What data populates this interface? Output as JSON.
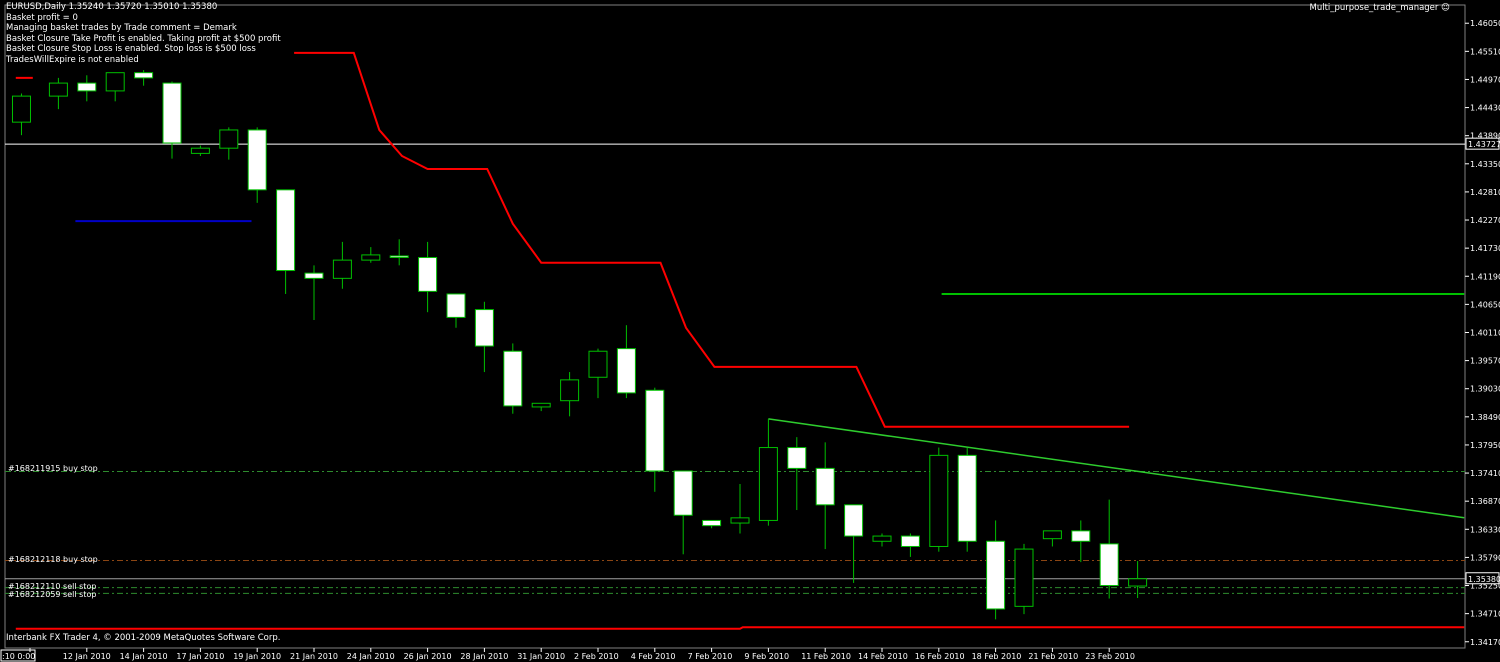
{
  "header": {
    "symbol_line": "EURUSD,Daily  1.35240 1.35720 1.35010 1.35380",
    "info_lines": [
      "Basket profit = 0",
      "Managing basket trades by Trade comment = Demark",
      "Basket Closure Take Profit is enabled. Taking profit at $500 profit",
      "Basket Closure Stop Loss is enabled. Stop loss is $500 loss",
      "TradesWillExpire is not enabled"
    ],
    "ea_name": "Multi_purpose_trade_manager"
  },
  "footer": {
    "copyright": "Interbank FX Trader 4, © 2001-2009 MetaQuotes Software Corp."
  },
  "orders": [
    {
      "label": "#168211915 buy stop",
      "price": 1.3744
    },
    {
      "label": "#168212118 buy stop",
      "price": 1.3573
    },
    {
      "label": "#168212110 sell stop",
      "price": 1.3521
    },
    {
      "label": "#168212059 sell stop",
      "price": 1.351
    }
  ],
  "colors": {
    "bull_body": "#000000",
    "bear_body": "#ffffff",
    "candle_outline": "#00c000",
    "red_line": "#ff0000",
    "blue_line": "#0000c8",
    "green_line": "#00c000",
    "trend_line": "#2ecc2e",
    "axis_text": "#ffffff",
    "order_line": "#2e8b2e",
    "order_line_red": "#8b4513"
  },
  "chart_data": {
    "type": "candlestick",
    "symbol": "EURUSD",
    "timeframe": "Daily",
    "current_price_label": "1.35380",
    "hline_white_label": "1.43727",
    "y_ticks": [
      1.4605,
      1.4551,
      1.4497,
      1.4443,
      1.4389,
      1.4335,
      1.4281,
      1.4227,
      1.4173,
      1.4119,
      1.4065,
      1.4011,
      1.3957,
      1.3903,
      1.3849,
      1.3795,
      1.3741,
      1.3687,
      1.3633,
      1.3579,
      1.3525,
      1.3471,
      1.3417
    ],
    "y_tick_labels": [
      "1.46050",
      "1.45510",
      "1.44970",
      "1.44430",
      "1.43890",
      "1.43350",
      "1.42810",
      "1.42270",
      "1.41730",
      "1.41190",
      "1.40650",
      "1.40110",
      "1.39570",
      "1.39030",
      "1.38490",
      "1.37950",
      "1.37410",
      "1.36870",
      "1.36330",
      "1.35790",
      "1.35250",
      "1.34710",
      "1.34170"
    ],
    "ylim": [
      1.3405,
      1.464
    ],
    "x_tick_labels": [
      {
        "index": 0,
        "label": ":10 0:00"
      },
      {
        "index": 2,
        "label": "12 Jan 2010"
      },
      {
        "index": 4,
        "label": "14 Jan 2010"
      },
      {
        "index": 6,
        "label": "17 Jan 2010"
      },
      {
        "index": 8,
        "label": "19 Jan 2010"
      },
      {
        "index": 10,
        "label": "21 Jan 2010"
      },
      {
        "index": 12,
        "label": "24 Jan 2010"
      },
      {
        "index": 14,
        "label": "26 Jan 2010"
      },
      {
        "index": 16,
        "label": "28 Jan 2010"
      },
      {
        "index": 18,
        "label": "31 Jan 2010"
      },
      {
        "index": 20,
        "label": "2 Feb 2010"
      },
      {
        "index": 22,
        "label": "4 Feb 2010"
      },
      {
        "index": 24,
        "label": "7 Feb 2010"
      },
      {
        "index": 26,
        "label": "9 Feb 2010"
      },
      {
        "index": 28,
        "label": "11 Feb 2010"
      },
      {
        "index": 30,
        "label": "14 Feb 2010"
      },
      {
        "index": 32,
        "label": "16 Feb 2010"
      },
      {
        "index": 34,
        "label": "18 Feb 2010"
      },
      {
        "index": 36,
        "label": "21 Feb 2010"
      },
      {
        "index": 38,
        "label": "23 Feb 2010"
      }
    ],
    "candles": [
      {
        "i": -0.3,
        "o": 1.4415,
        "h": 1.447,
        "l": 1.439,
        "c": 1.4465
      },
      {
        "i": 1,
        "o": 1.4465,
        "h": 1.45,
        "l": 1.444,
        "c": 1.449
      },
      {
        "i": 2,
        "o": 1.449,
        "h": 1.4505,
        "l": 1.4455,
        "c": 1.4475
      },
      {
        "i": 3,
        "o": 1.4475,
        "h": 1.451,
        "l": 1.4455,
        "c": 1.451
      },
      {
        "i": 4,
        "o": 1.451,
        "h": 1.4515,
        "l": 1.4485,
        "c": 1.45
      },
      {
        "i": 5,
        "o": 1.449,
        "h": 1.4493,
        "l": 1.4345,
        "c": 1.4375
      },
      {
        "i": 6,
        "o": 1.4355,
        "h": 1.437,
        "l": 1.435,
        "c": 1.4365
      },
      {
        "i": 7,
        "o": 1.4365,
        "h": 1.4405,
        "l": 1.4343,
        "c": 1.44
      },
      {
        "i": 8,
        "o": 1.44,
        "h": 1.4405,
        "l": 1.426,
        "c": 1.4285
      },
      {
        "i": 9,
        "o": 1.4285,
        "h": 1.4285,
        "l": 1.4085,
        "c": 1.413
      },
      {
        "i": 10,
        "o": 1.4125,
        "h": 1.414,
        "l": 1.4035,
        "c": 1.4115
      },
      {
        "i": 11,
        "o": 1.4115,
        "h": 1.4185,
        "l": 1.4095,
        "c": 1.415
      },
      {
        "i": 12,
        "o": 1.415,
        "h": 1.4175,
        "l": 1.4145,
        "c": 1.416
      },
      {
        "i": 13,
        "o": 1.4158,
        "h": 1.419,
        "l": 1.414,
        "c": 1.4155
      },
      {
        "i": 14,
        "o": 1.4155,
        "h": 1.4185,
        "l": 1.405,
        "c": 1.409
      },
      {
        "i": 15,
        "o": 1.4085,
        "h": 1.4085,
        "l": 1.402,
        "c": 1.404
      },
      {
        "i": 16,
        "o": 1.4055,
        "h": 1.407,
        "l": 1.3935,
        "c": 1.3985
      },
      {
        "i": 17,
        "o": 1.3975,
        "h": 1.399,
        "l": 1.3855,
        "c": 1.387
      },
      {
        "i": 18,
        "o": 1.3868,
        "h": 1.3875,
        "l": 1.386,
        "c": 1.3875
      },
      {
        "i": 19,
        "o": 1.388,
        "h": 1.3935,
        "l": 1.385,
        "c": 1.392
      },
      {
        "i": 20,
        "o": 1.3925,
        "h": 1.398,
        "l": 1.3885,
        "c": 1.3975
      },
      {
        "i": 21,
        "o": 1.398,
        "h": 1.4025,
        "l": 1.3885,
        "c": 1.3895
      },
      {
        "i": 22,
        "o": 1.39,
        "h": 1.3905,
        "l": 1.3705,
        "c": 1.3745
      },
      {
        "i": 23,
        "o": 1.3745,
        "h": 1.3745,
        "l": 1.3585,
        "c": 1.366
      },
      {
        "i": 24,
        "o": 1.365,
        "h": 1.365,
        "l": 1.3635,
        "c": 1.364
      },
      {
        "i": 25,
        "o": 1.3645,
        "h": 1.372,
        "l": 1.3625,
        "c": 1.3655
      },
      {
        "i": 26,
        "o": 1.365,
        "h": 1.3845,
        "l": 1.364,
        "c": 1.379
      },
      {
        "i": 27,
        "o": 1.379,
        "h": 1.381,
        "l": 1.367,
        "c": 1.375
      },
      {
        "i": 28,
        "o": 1.375,
        "h": 1.38,
        "l": 1.3595,
        "c": 1.368
      },
      {
        "i": 29,
        "o": 1.368,
        "h": 1.368,
        "l": 1.353,
        "c": 1.362
      },
      {
        "i": 30,
        "o": 1.361,
        "h": 1.3625,
        "l": 1.36,
        "c": 1.362
      },
      {
        "i": 31,
        "o": 1.362,
        "h": 1.3625,
        "l": 1.358,
        "c": 1.36
      },
      {
        "i": 32,
        "o": 1.36,
        "h": 1.379,
        "l": 1.359,
        "c": 1.3775
      },
      {
        "i": 33,
        "o": 1.3775,
        "h": 1.379,
        "l": 1.359,
        "c": 1.361
      },
      {
        "i": 34,
        "o": 1.361,
        "h": 1.365,
        "l": 1.346,
        "c": 1.348
      },
      {
        "i": 35,
        "o": 1.3485,
        "h": 1.3605,
        "l": 1.347,
        "c": 1.3595
      },
      {
        "i": 36,
        "o": 1.3615,
        "h": 1.363,
        "l": 1.36,
        "c": 1.363
      },
      {
        "i": 37,
        "o": 1.363,
        "h": 1.365,
        "l": 1.357,
        "c": 1.361
      },
      {
        "i": 38,
        "o": 1.3605,
        "h": 1.369,
        "l": 1.35,
        "c": 1.3525
      },
      {
        "i": 39,
        "o": 1.3524,
        "h": 1.3572,
        "l": 1.3501,
        "c": 1.3538
      }
    ],
    "red_stepline": [
      [
        -0.5,
        1.45
      ],
      [
        0.1,
        1.45
      ],
      [
        9.3,
        1.4548
      ],
      [
        11.4,
        1.4548
      ],
      [
        12.3,
        1.44
      ],
      [
        13.1,
        1.435
      ],
      [
        14.0,
        1.4325
      ],
      [
        16.1,
        1.4325
      ],
      [
        17.0,
        1.422
      ],
      [
        18.0,
        1.4145
      ],
      [
        22.2,
        1.4145
      ],
      [
        23.1,
        1.402
      ],
      [
        24.1,
        1.3945
      ],
      [
        29.1,
        1.3945
      ],
      [
        30.1,
        1.383
      ],
      [
        38.7,
        1.383
      ]
    ],
    "blue_line": [
      [
        1.6,
        1.4225
      ],
      [
        7.8,
        1.4225
      ]
    ],
    "green_hline": [
      [
        32.1,
        1.4085
      ],
      [
        50.5,
        1.4085
      ]
    ],
    "trend_line": [
      [
        26.0,
        1.3845
      ],
      [
        50.5,
        1.3655
      ]
    ],
    "white_hline_price": 1.43727,
    "current_hline_price": 1.3538,
    "red_bottom_line": [
      [
        -0.5,
        1.3442
      ],
      [
        25.0,
        1.3442
      ],
      [
        25.1,
        1.3445
      ],
      [
        50.5,
        1.3445
      ]
    ]
  }
}
